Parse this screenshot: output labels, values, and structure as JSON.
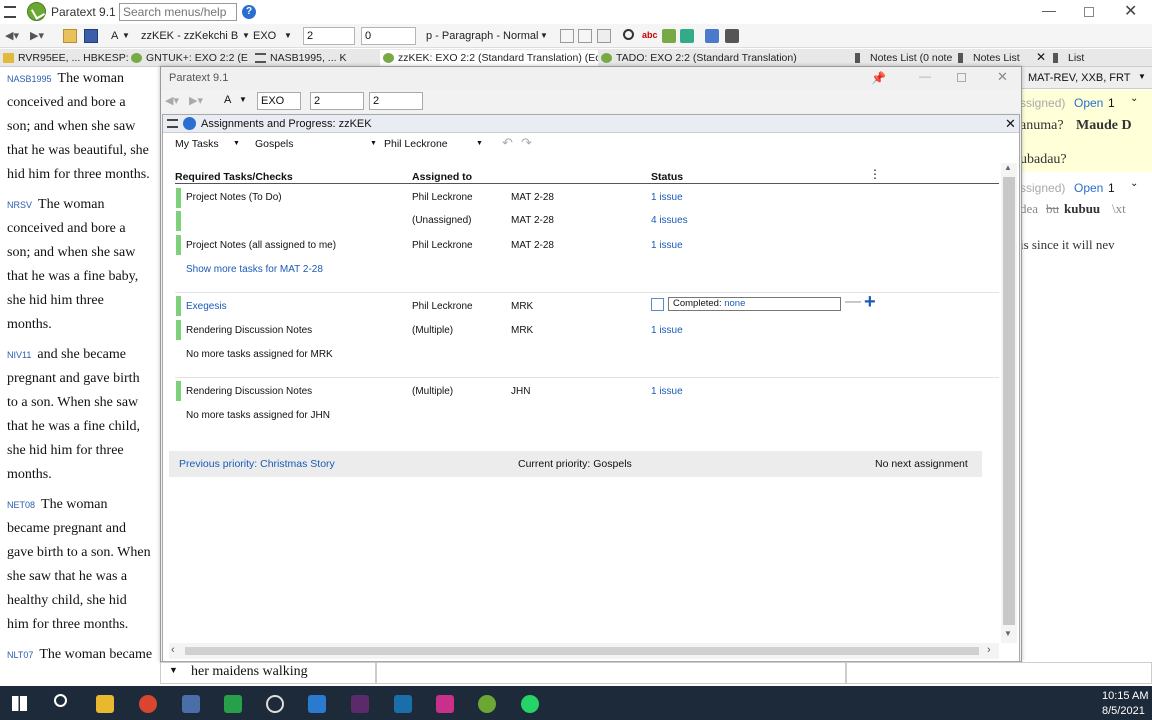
{
  "app": {
    "title": "Paratext 9.1",
    "search_placeholder": "Search menus/help"
  },
  "toolbar": {
    "font": "A",
    "project": "zzKEK - zzKekchi B",
    "book": "EXO",
    "chapter": "2",
    "verse": "0",
    "style": "p - Paragraph - Normal"
  },
  "tabs": [
    {
      "label": "RVR95EE, ... HBKESP: E"
    },
    {
      "label": "GNTUK+: EXO 2:2 (Enh"
    },
    {
      "label": "NASB1995, ... K"
    },
    {
      "label": "zzKEK: EXO 2:2 (Standard Translation) (Ec"
    },
    {
      "label": "TADO: EXO 2:2 (Standard Translation)"
    },
    {
      "label": "Notes List (0 note"
    },
    {
      "label": "Notes List"
    },
    {
      "label": "List"
    }
  ],
  "left": [
    {
      "ref": "NASB1995",
      "lines": [
        "The woman",
        "conceived and bore a",
        "son; and when she saw",
        "that he was beautiful, she",
        "hid him for three months."
      ]
    },
    {
      "ref": "NRSV",
      "lines": [
        "The woman",
        "conceived and bore a",
        "son; and when she saw",
        "that he was a fine baby,",
        "she hid him three",
        "months."
      ]
    },
    {
      "ref": "NIV11",
      "lines": [
        "and she became",
        "pregnant and gave birth",
        "to a son. When she saw",
        "that he was a fine child,",
        "she hid him for three",
        "months."
      ]
    },
    {
      "ref": "NET08",
      "lines": [
        "The woman",
        "became pregnant and",
        "gave birth to a son. When",
        "she saw that he was a",
        "healthy child, she hid",
        "him for three months."
      ]
    },
    {
      "ref": "NLT07",
      "lines": [
        "The woman became"
      ]
    }
  ],
  "right": {
    "filter": "MAT-REV, XXB, FRT",
    "open1": "Open",
    "num1": "1",
    "text1a": "anuma?",
    "text1b": "Maude D",
    "text2": "ubadau?",
    "open2": "Open",
    "num2": "1",
    "note_frag1": "ssigned)",
    "note_frag2": "ssigned)",
    "text3a": "dea",
    "text3b": "bu",
    "text3c": "kubuu",
    "text3d": "\\xt",
    "text4": "is since it will nev"
  },
  "window": {
    "title": "Paratext 9.1",
    "book": "EXO",
    "chapter": "2",
    "verse": "2",
    "font": "A"
  },
  "panel": {
    "title": "Assignments and Progress: zzKEK",
    "filter_tasks": "My Tasks",
    "filter_priority": "Gospels",
    "filter_user": "Phil Leckrone",
    "col_task": "Required Tasks/Checks",
    "col_assigned": "Assigned to",
    "col_status": "Status",
    "rows": [
      {
        "task": "Project Notes (To Do)",
        "assigned": "Phil Leckrone",
        "range": "MAT 2-28",
        "status": "1 issue",
        "bar": true,
        "link": false
      },
      {
        "task": "",
        "assigned": "(Unassigned)",
        "range": "MAT 2-28",
        "status": "4 issues",
        "bar": true,
        "link": false
      },
      {
        "task": "Project Notes (all assigned to me)",
        "assigned": "Phil Leckrone",
        "range": "MAT 2-28",
        "status": "1 issue",
        "bar": true,
        "link": false
      },
      {
        "task": "Show more tasks for MAT 2-28",
        "assigned": "",
        "range": "",
        "status": "",
        "bar": false,
        "link": true
      },
      {
        "task": "Exegesis",
        "assigned": "Phil Leckrone",
        "range": "MRK",
        "status": "",
        "bar": true,
        "link": true
      },
      {
        "task": "Rendering Discussion Notes",
        "assigned": "(Multiple)",
        "range": "MRK",
        "status": "1 issue",
        "bar": true,
        "link": false
      },
      {
        "task": "No more tasks assigned for MRK",
        "assigned": "",
        "range": "",
        "status": "",
        "bar": false,
        "link": false
      },
      {
        "task": "Rendering Discussion Notes",
        "assigned": "(Multiple)",
        "range": "JHN",
        "status": "1 issue",
        "bar": true,
        "link": false
      },
      {
        "task": "No more tasks assigned for JHN",
        "assigned": "",
        "range": "",
        "status": "",
        "bar": false,
        "link": false
      }
    ],
    "completed_label": "Completed:",
    "completed_value": "none",
    "prev_priority": "Previous priority: Christmas Story",
    "current_priority": "Current priority: Gospels",
    "next_priority": "No next assignment"
  },
  "bottom_text": "her maidens walking",
  "taskbar": {
    "time": "10:15 AM",
    "date": "8/5/2021"
  }
}
